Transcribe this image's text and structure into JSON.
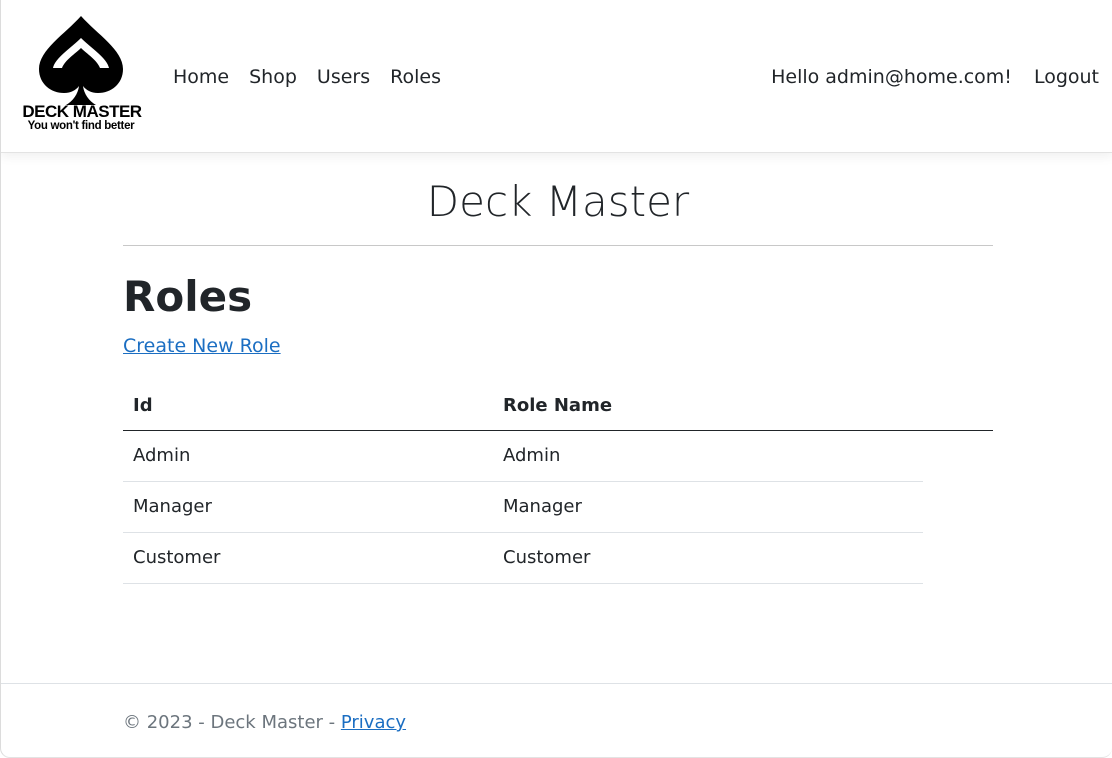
{
  "brand": {
    "logo_title": "DECK MASTER",
    "logo_tagline": "You won't find better"
  },
  "nav": {
    "items": [
      {
        "label": "Home"
      },
      {
        "label": "Shop"
      },
      {
        "label": "Users"
      },
      {
        "label": "Roles"
      }
    ],
    "greeting": "Hello admin@home.com!",
    "logout": "Logout"
  },
  "main": {
    "site_title": "Deck Master",
    "page_heading": "Roles",
    "create_link": "Create New Role",
    "table": {
      "headers": [
        "Id",
        "Role Name"
      ],
      "rows": [
        [
          "Admin",
          "Admin"
        ],
        [
          "Manager",
          "Manager"
        ],
        [
          "Customer",
          "Customer"
        ]
      ]
    }
  },
  "footer": {
    "copyright": "© 2023 - Deck Master - ",
    "privacy": "Privacy"
  },
  "colors": {
    "link": "#1b6ec2",
    "text": "#212529",
    "muted": "#6c757d"
  }
}
